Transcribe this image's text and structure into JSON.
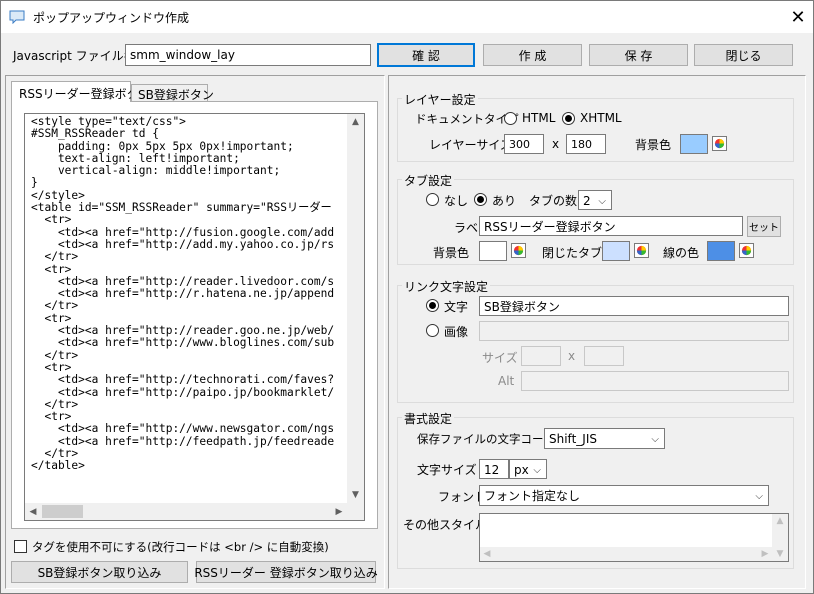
{
  "window": {
    "title": "ポップアップウィンドウ作成",
    "close": "✕"
  },
  "top": {
    "filename_label": "Javascript ファイル名",
    "filename_value": "smm_window_lay",
    "buttons": {
      "confirm": "確 認",
      "create": "作 成",
      "save": "保 存",
      "close": "閉じる"
    }
  },
  "left": {
    "tabs": [
      "RSSリーダー登録ボタン",
      "SB登録ボタン"
    ],
    "code": "<style type=\"text/css\">\n#SSM_RSSReader td {\n    padding: 0px 5px 5px 0px!important;\n    text-align: left!important;\n    vertical-align: middle!important;\n}\n</style>\n<table id=\"SSM_RSSReader\" summary=\"RSSリーダー\n  <tr>\n    <td><a href=\"http://fusion.google.com/add\n    <td><a href=\"http://add.my.yahoo.co.jp/rs\n  </tr>\n  <tr>\n    <td><a href=\"http://reader.livedoor.com/s\n    <td><a href=\"http://r.hatena.ne.jp/append\n  </tr>\n  <tr>\n    <td><a href=\"http://reader.goo.ne.jp/web/\n    <td><a href=\"http://www.bloglines.com/sub\n  </tr>\n  <tr>\n    <td><a href=\"http://technorati.com/faves?\n    <td><a href=\"http://paipo.jp/bookmarklet/\n  </tr>\n  <tr>\n    <td><a href=\"http://www.newsgator.com/ngs\n    <td><a href=\"http://feedpath.jp/feedreade\n  </tr>\n</table>",
    "disable_tags_label": "タグを使用不可にする(改行コードは <br /> に自動変換)",
    "disable_tags_checked": false,
    "import_sb": "SB登録ボタン取り込み",
    "import_rss": "RSSリーダー 登録ボタン取り込み"
  },
  "layer": {
    "title": "レイヤー設定",
    "doc_type_label": "ドキュメントタイプ",
    "doc_types": [
      "HTML",
      "XHTML"
    ],
    "doc_type_selected": "XHTML",
    "size_label": "レイヤーサイズ",
    "width": "300",
    "times": "x",
    "height": "180",
    "bg_label": "背景色",
    "bg_color": "#99ccff"
  },
  "tab_settings": {
    "title": "タブ設定",
    "options": [
      "なし",
      "あり"
    ],
    "selected": "あり",
    "count_label": "タブの数",
    "count": "2",
    "label_label": "ラベル",
    "label_value": "RSSリーダー登録ボタン",
    "set_button": "セット",
    "bg_label": "背景色",
    "bg_color": "#ffffff",
    "closed_tab_label": "閉じたタブ",
    "closed_tab_color": "#cce0ff",
    "line_color_label": "線の色",
    "line_color": "#4d8fe6"
  },
  "link_text": {
    "title": "リンク文字設定",
    "text_label": "文字",
    "text_value": "SB登録ボタン",
    "image_label": "画像",
    "selected": "文字",
    "size_label": "サイズ",
    "times": "x",
    "alt_label": "Alt"
  },
  "format": {
    "title": "書式設定",
    "encoding_label": "保存ファイルの文字コード",
    "encoding_value": "Shift_JIS",
    "font_size_label": "文字サイズ",
    "font_size_value": "12",
    "font_size_unit": "px",
    "font_label": "フォント",
    "font_value": "フォント指定なし",
    "other_style_label": "その他スタイル"
  },
  "icons": {
    "app": "speech-bubble-icon",
    "picker": "color-wheel-icon"
  },
  "colors": {
    "accent": "#0078d7"
  }
}
